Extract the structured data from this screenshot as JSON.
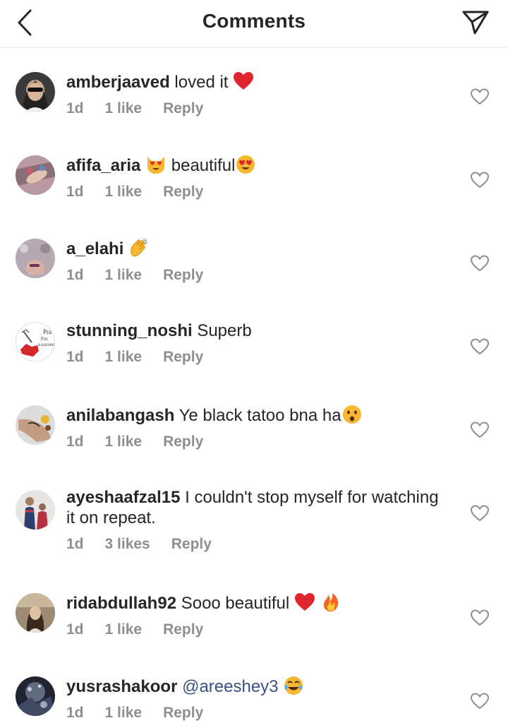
{
  "header": {
    "title": "Comments",
    "back_icon": "chevron-left-icon",
    "send_icon": "paper-plane-icon"
  },
  "comments": [
    {
      "username": "amberjaaved",
      "text": " loved it ",
      "emojis": [
        "red-heart"
      ],
      "time": "1d",
      "likes": "1 like",
      "reply": "Reply"
    },
    {
      "username": "afifa_aria",
      "text": "  beautiful",
      "emojis_before": [
        "heart-eyes-cat"
      ],
      "emojis": [
        "heart-eyes"
      ],
      "time": "1d",
      "likes": "1 like",
      "reply": "Reply"
    },
    {
      "username": "a_elahi",
      "text": " ",
      "emojis": [
        "clapping-hands"
      ],
      "time": "1d",
      "likes": "1 like",
      "reply": "Reply"
    },
    {
      "username": "stunning_noshi",
      "text": " Superb",
      "emojis": [],
      "time": "1d",
      "likes": "1 like",
      "reply": "Reply"
    },
    {
      "username": "anilabangash",
      "text": " Ye black tatoo bna ha",
      "emojis": [
        "surprised-face"
      ],
      "time": "1d",
      "likes": "1 like",
      "reply": "Reply"
    },
    {
      "username": "ayeshaafzal15",
      "text": " I couldn't stop myself for watching it on repeat.",
      "emojis": [],
      "time": "1d",
      "likes": "3 likes",
      "reply": "Reply"
    },
    {
      "username": "ridabdullah92",
      "text": " Sooo beautiful ",
      "emojis": [
        "red-heart",
        "fire"
      ],
      "time": "1d",
      "likes": "1 like",
      "reply": "Reply"
    },
    {
      "username": "yusrashakoor",
      "text": " ",
      "mention": "@areeshey3",
      "emojis": [
        "tears-of-joy"
      ],
      "time": "1d",
      "likes": "1 like",
      "reply": "Reply"
    }
  ],
  "avatar_text": {
    "stunning_noshi": [
      "Pra",
      "For",
      "KASHMIR"
    ]
  },
  "colors": {
    "text": "#262626",
    "meta": "#8e8e8e",
    "mention": "#385185",
    "divider": "#e6e6e6"
  }
}
